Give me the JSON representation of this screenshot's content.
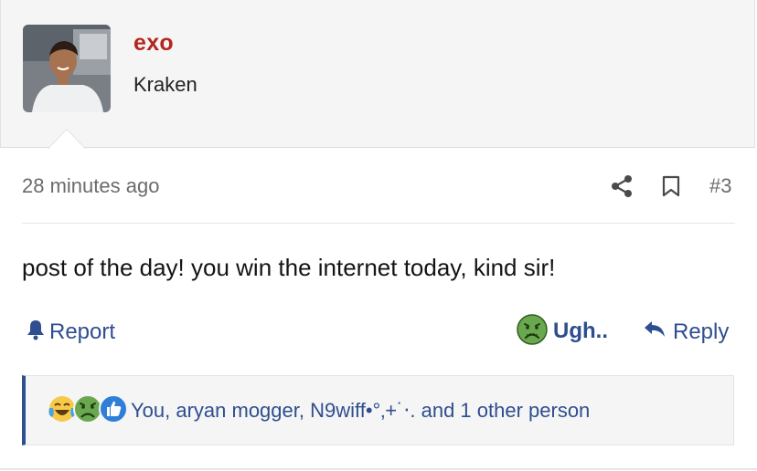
{
  "post": {
    "author": {
      "username": "exo",
      "title": "Kraken",
      "avatar_icon": "user-avatar-photo",
      "username_color": "#b3261e"
    },
    "timestamp": "28 minutes ago",
    "post_number": "#3",
    "body": "post of the day! you win the internet today, kind sir!",
    "actions": {
      "report_label": "Report",
      "reaction_label": "Ugh..",
      "reply_label": "Reply"
    },
    "reactions": {
      "icons": [
        "laughing-crying-emoji-icon",
        "nauseated-face-icon",
        "thumbs-up-icon"
      ],
      "summary": "You, aryan mogger, N9wiff•°‚+˙‧. and 1 other person"
    }
  },
  "colors": {
    "accent": "#2f4e8f",
    "header_bg": "#f5f5f5",
    "muted_text": "#6b6b6b"
  },
  "icons": {
    "share": "share-icon",
    "bookmark": "bookmark-icon",
    "report": "bell-icon",
    "reply": "reply-arrow-icon"
  }
}
